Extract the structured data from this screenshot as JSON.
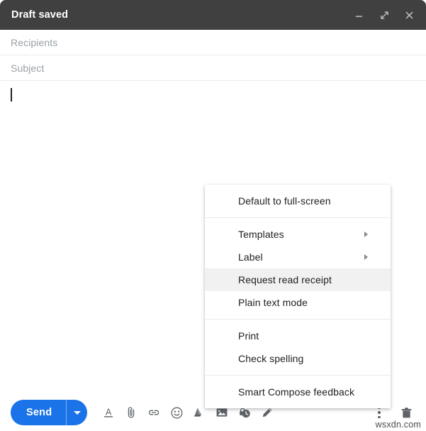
{
  "window": {
    "title": "Draft saved",
    "controls": [
      {
        "name": "minimize",
        "label": "Minimize"
      },
      {
        "name": "expand",
        "label": "Full screen"
      },
      {
        "name": "close",
        "label": "Save & close"
      }
    ],
    "header_bg": "#404040",
    "header_text_color": "#ffffff"
  },
  "fields": {
    "recipients_placeholder": "Recipients",
    "recipients_value": "",
    "subject_placeholder": "Subject",
    "subject_value": "",
    "body_value": ""
  },
  "menu": {
    "groups": [
      {
        "items": [
          {
            "label": "Default to full-screen",
            "icon": "",
            "submenu": false,
            "highlighted": false
          }
        ]
      },
      {
        "items": [
          {
            "label": "Templates",
            "icon": "chevron-right-icon",
            "submenu": true,
            "highlighted": false
          },
          {
            "label": "Label",
            "icon": "chevron-right-icon",
            "submenu": true,
            "highlighted": false
          },
          {
            "label": "Request read receipt",
            "icon": "",
            "submenu": false,
            "highlighted": true
          },
          {
            "label": "Plain text mode",
            "icon": "",
            "submenu": false,
            "highlighted": false
          }
        ]
      },
      {
        "items": [
          {
            "label": "Print",
            "icon": "",
            "submenu": false,
            "highlighted": false
          },
          {
            "label": "Check spelling",
            "icon": "",
            "submenu": false,
            "highlighted": false
          }
        ]
      },
      {
        "items": [
          {
            "label": "Smart Compose feedback",
            "icon": "",
            "submenu": false,
            "highlighted": false
          }
        ]
      }
    ],
    "highlight_color": "#f1f1f1"
  },
  "toolbar": {
    "send_label": "Send",
    "send_color": "#1a73e8",
    "send_options_icon": "caret-down-icon",
    "icons": [
      {
        "name": "formatting-options-icon",
        "label": "Formatting options"
      },
      {
        "name": "attach-file-icon",
        "label": "Attach files"
      },
      {
        "name": "insert-link-icon",
        "label": "Insert link"
      },
      {
        "name": "insert-emoji-icon",
        "label": "Insert emoji"
      },
      {
        "name": "insert-drive-file-icon",
        "label": "Insert files using Drive"
      },
      {
        "name": "insert-photo-icon",
        "label": "Insert photo"
      },
      {
        "name": "confidential-mode-icon",
        "label": "Toggle confidential mode"
      },
      {
        "name": "insert-signature-icon",
        "label": "Insert signature"
      }
    ],
    "more_options_label": "More options",
    "discard_label": "Discard draft"
  },
  "watermark": "wsxdn.com"
}
